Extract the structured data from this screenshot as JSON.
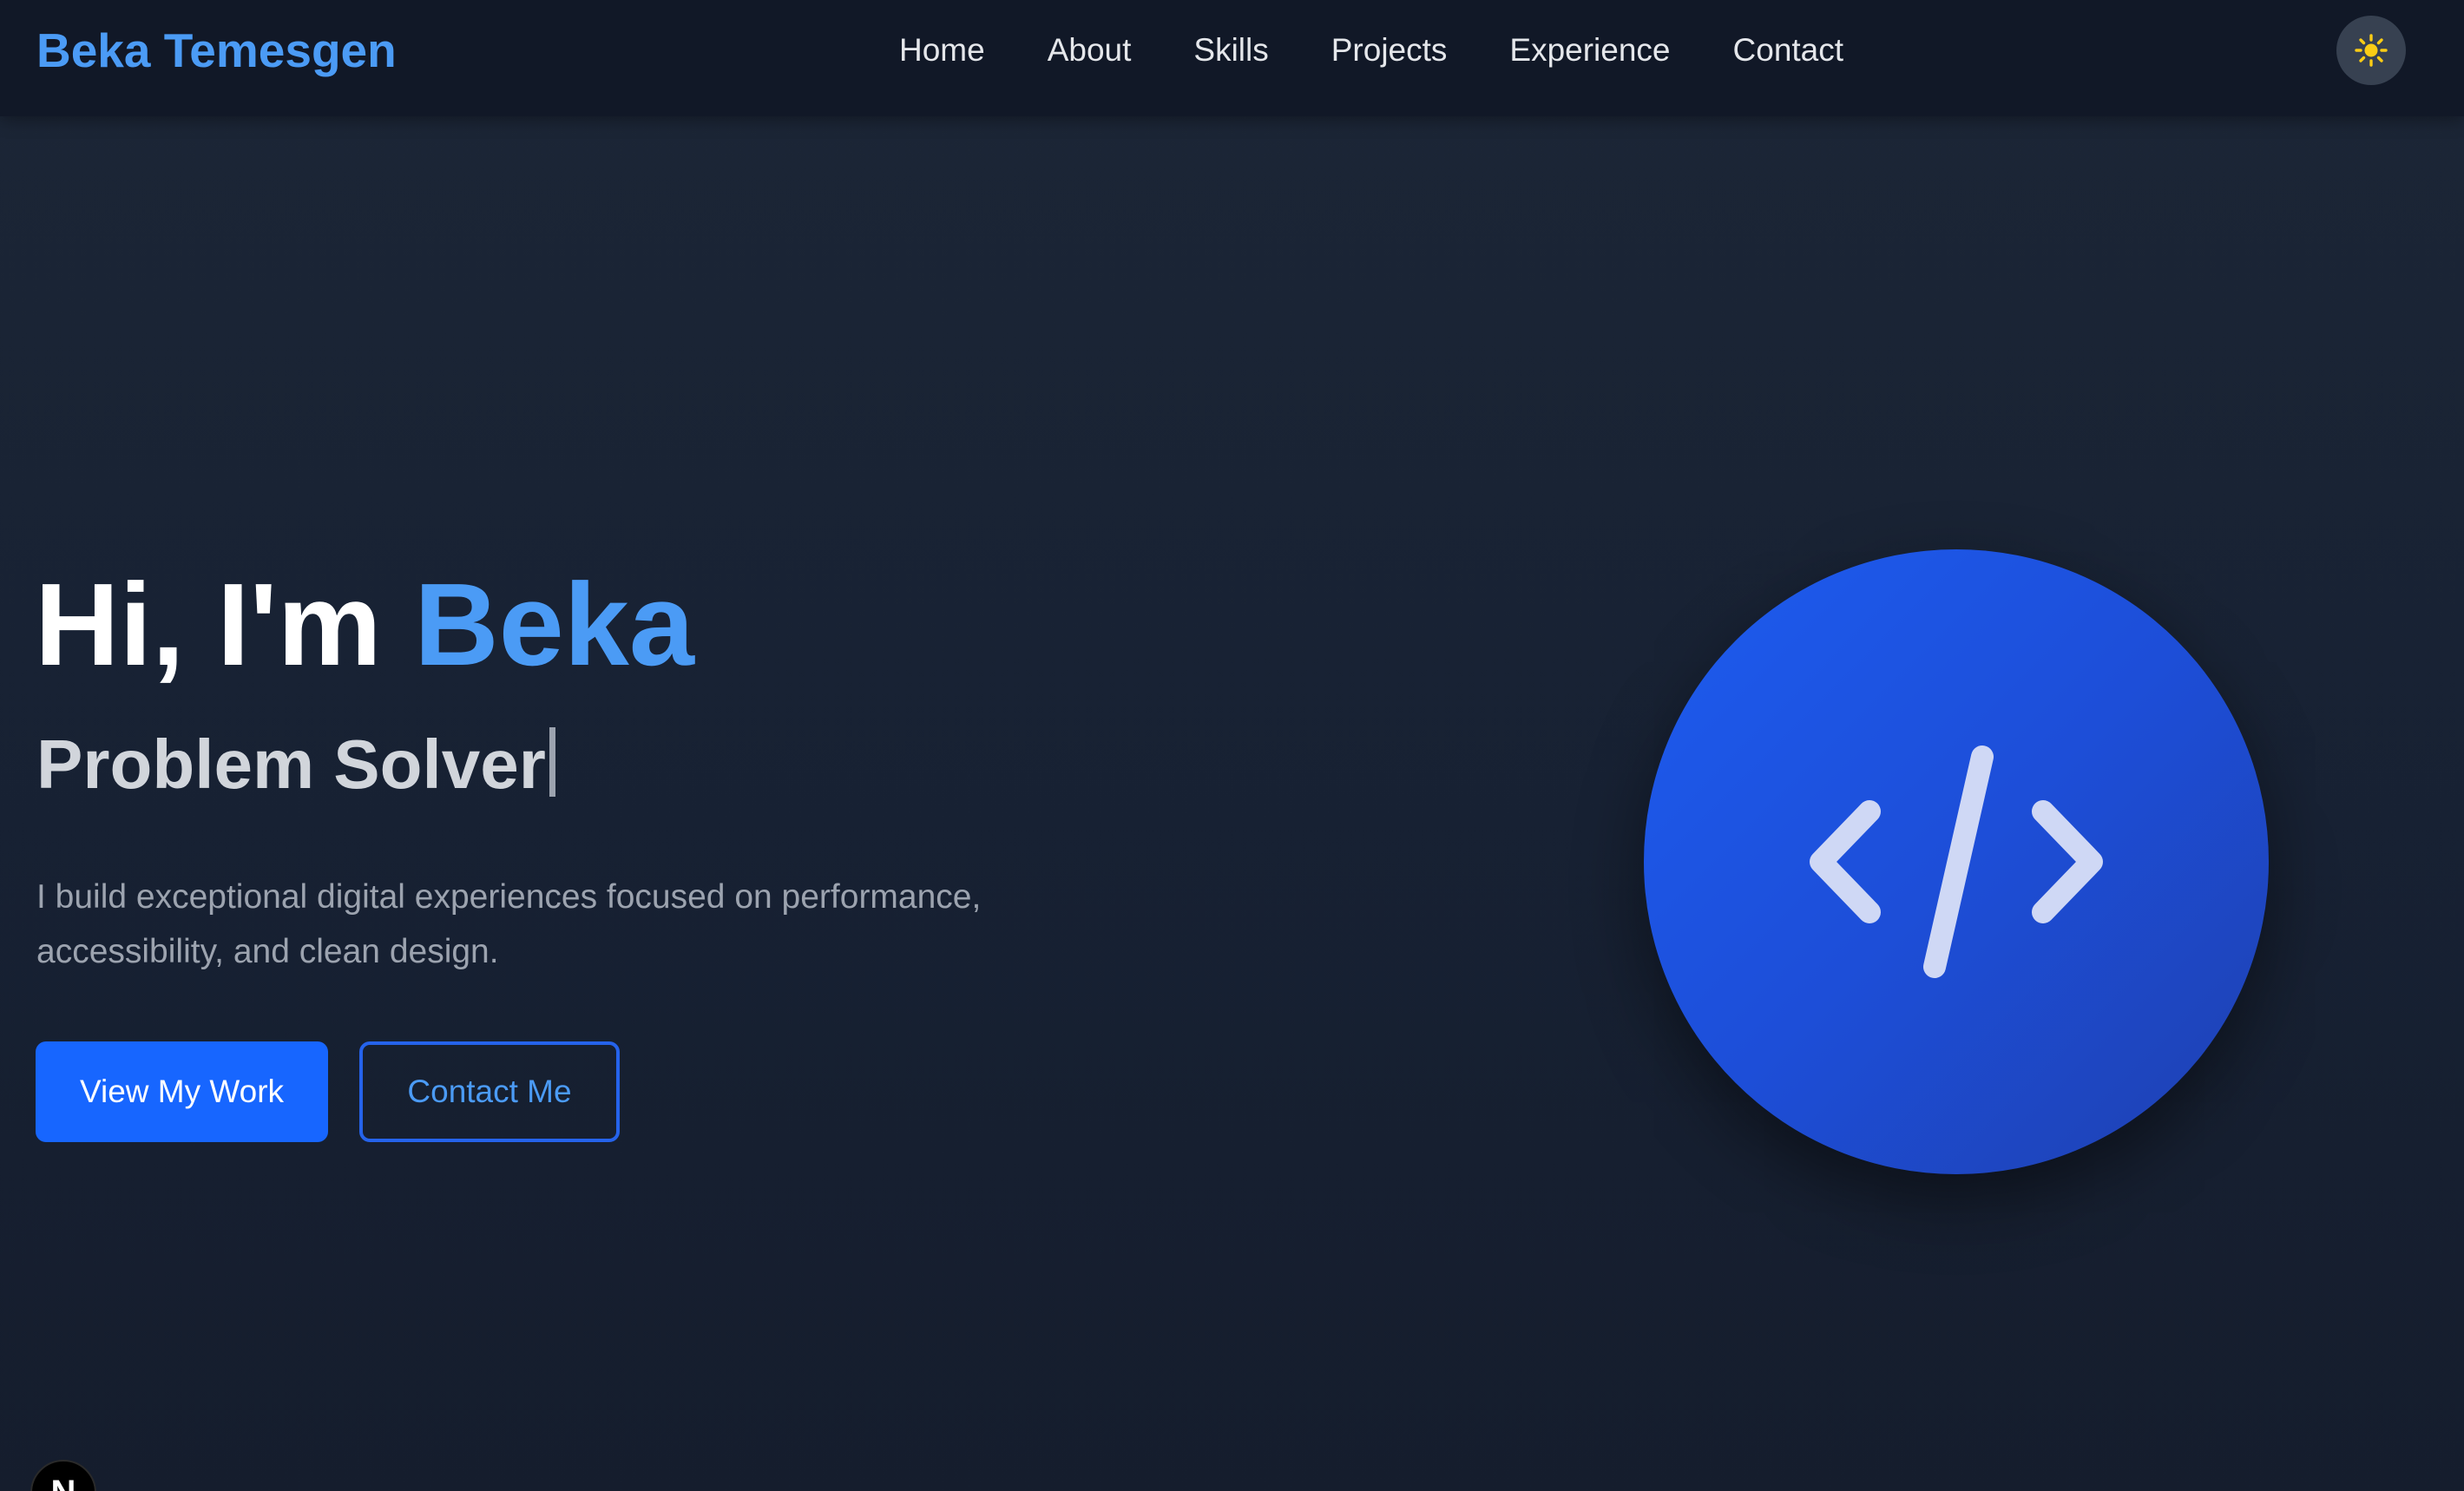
{
  "header": {
    "brand": "Beka Temesgen",
    "nav": [
      {
        "label": "Home"
      },
      {
        "label": "About"
      },
      {
        "label": "Skills"
      },
      {
        "label": "Projects"
      },
      {
        "label": "Experience"
      },
      {
        "label": "Contact"
      }
    ],
    "theme_toggle_icon": "sun-icon"
  },
  "hero": {
    "greeting": "Hi, I'm",
    "name": "Beka",
    "role": "Problem Solver",
    "description": "I build exceptional digital experiences focused on performance, accessibility, and clean design.",
    "primary_button": "View My Work",
    "secondary_button": "Contact Me",
    "illustration_icon": "code-icon"
  },
  "dev_badge": {
    "label": "N",
    "icon": "nextjs-icon"
  },
  "colors": {
    "accent": "#4b9bf5",
    "primary_button": "#1766ff",
    "nav_background": "#111827",
    "page_background": "#172133",
    "sun": "#facc15"
  }
}
